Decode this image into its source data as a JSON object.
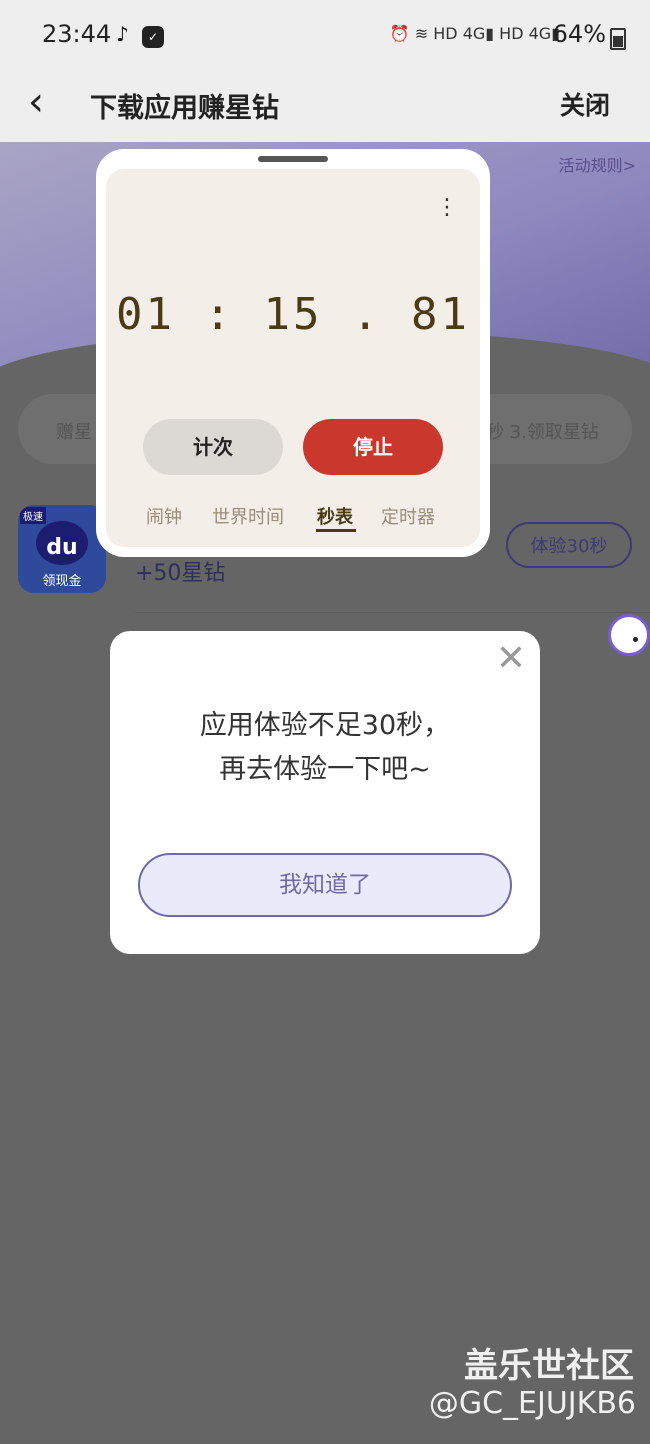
{
  "status_bar": {
    "time": "23:44",
    "network_icons": "⏰ ≋ HD 4G▮ HD 4G▮",
    "battery": "64%"
  },
  "header": {
    "title": "下载应用赚星钻",
    "close_label": "关闭"
  },
  "background": {
    "rules_link": "活动规则>",
    "step1": "赠星",
    "step3": "秒 3.领取星钻",
    "app_icon_badge": "极速",
    "app_icon_text": "du",
    "app_icon_caption": "领现金",
    "reward": "+50星钻",
    "try_button": "体验30秒"
  },
  "stopwatch": {
    "more_icon": "⋮",
    "time": "01 : 15 . 81",
    "lap_label": "计次",
    "stop_label": "停止",
    "tabs": [
      "闹钟",
      "世界时间",
      "秒表",
      "定时器"
    ],
    "active_tab": "秒表"
  },
  "dialog": {
    "line1": "应用体验不足30秒，",
    "line2": "再去体验一下吧~",
    "ok_label": "我知道了",
    "close_icon": "✕"
  },
  "watermark": {
    "line1": "盖乐世社区",
    "line2": "@GC_EJUJKB6"
  }
}
